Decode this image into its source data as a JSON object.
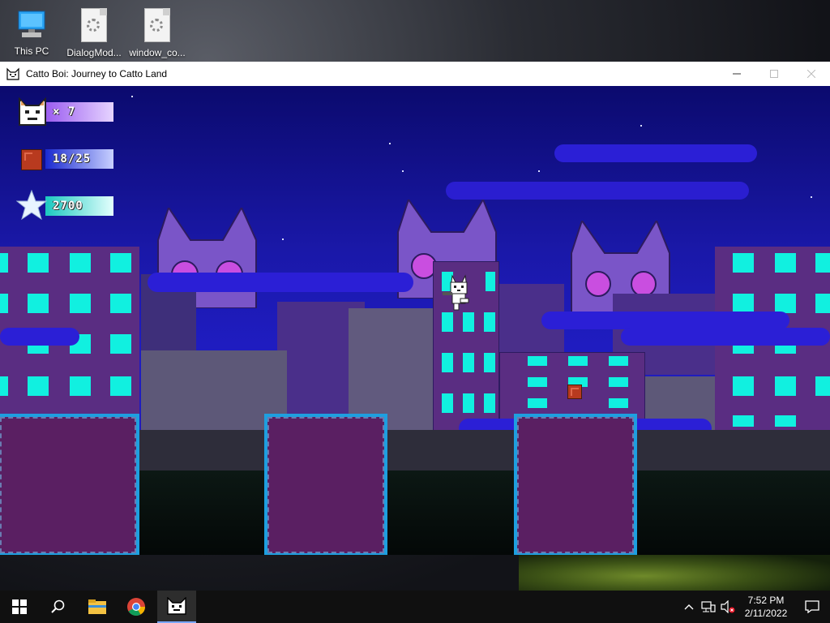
{
  "desktop": {
    "icons": [
      {
        "label": "This PC",
        "icon": "computer-icon"
      },
      {
        "label": "DialogMod...",
        "icon": "settings-file-icon"
      },
      {
        "label": "window_co...",
        "icon": "settings-file-icon"
      }
    ]
  },
  "window": {
    "title": "Catto Boi: Journey to Catto Land",
    "controls": [
      "minimize",
      "maximize",
      "close"
    ]
  },
  "hud": {
    "lives": "× 7",
    "coins": "18/25",
    "score": "2700"
  },
  "taskbar": {
    "time": "7:52 PM",
    "date": "2/11/2022",
    "apps": [
      "start-icon",
      "search-icon",
      "file-explorer-icon",
      "chrome-icon",
      "catto-boi-app-icon"
    ],
    "tray": [
      "chevron-up-icon",
      "network-icon",
      "volume-muted-icon",
      "notification-icon"
    ]
  },
  "colors": {
    "sky": "#1e1bb8",
    "building_purple": "#5a2d82",
    "window_cyan": "#11f0e0",
    "platform_fill": "#5a1f62",
    "platform_edge": "#1e9fe0"
  }
}
